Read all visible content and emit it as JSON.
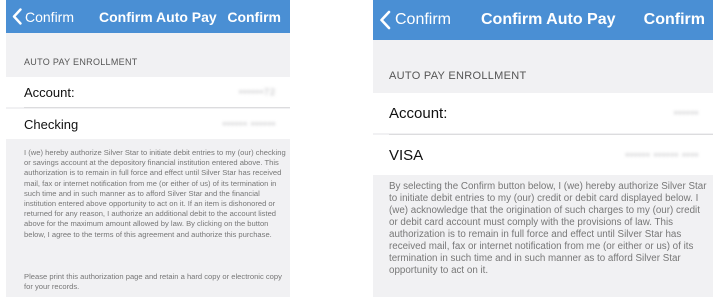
{
  "left_screen": {
    "navbar": {
      "back_label": "Confirm",
      "title": "Confirm Auto Pay",
      "action_label": "Confirm"
    },
    "section_header": "AUTO PAY ENROLLMENT",
    "rows": [
      {
        "label": "Account:",
        "value": "••••••72"
      },
      {
        "label": "Checking",
        "value": "•••••• ••••••"
      }
    ],
    "authorization_text": "I (we) hereby authorize Silver Star to initiate debit entries to my (our) checking or savings account at the depository financial institution entered above. This authorization is to remain in full force and effect until Silver Star has received mail, fax or internet notification from me (or either of us) of its termination in such time and in such manner as to afford Silver Star and the financial institution entered above opportunity to act on it. If an item is dishonored or returned for any reason, I authorize an additional debit to the account listed above for the maximum amount allowed by law. By clicking on the button below, I agree to the terms of this agreement and authorize this purchase.",
    "print_text": "Please print this authorization page and retain a hard copy or electronic copy for your records."
  },
  "right_screen": {
    "navbar": {
      "back_label": "Confirm",
      "title": "Confirm Auto Pay",
      "action_label": "Confirm"
    },
    "section_header": "AUTO PAY ENROLLMENT",
    "rows": [
      {
        "label": "Account:",
        "value": "••••••"
      },
      {
        "label": "VISA",
        "value": "•••••• •••••• ••••"
      }
    ],
    "authorization_text": "By selecting the Confirm button below, I (we) hereby authorize Silver Star to initiate debit entries to my (our) credit or debit card displayed below. I (we) acknowledge that the origination of such charges to my (our) credit or debit card account must comply with the provisions of law. This authorization is to remain in full force and effect until Silver Star has received mail, fax or internet notification from me (or either or us) of its termination in such time and in such manner as to afford Silver Star opportunity to act on it."
  },
  "colors": {
    "navbar": "#4a8fd4",
    "background": "#f1f1f3",
    "cell": "#ffffff"
  },
  "icons": {
    "back": "chevron-left-icon"
  }
}
